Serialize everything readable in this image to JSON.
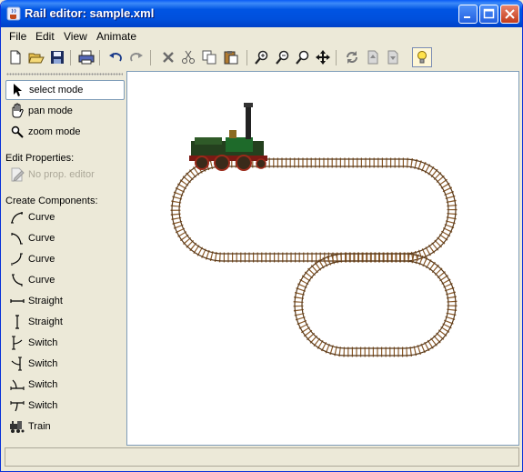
{
  "window": {
    "title": "Rail editor: sample.xml"
  },
  "menu": [
    "File",
    "Edit",
    "View",
    "Animate"
  ],
  "toolbar": {
    "icons": [
      "new-file-icon",
      "open-folder-icon",
      "save-icon",
      "print-icon",
      "undo-icon",
      "redo-icon",
      "delete-icon",
      "cut-icon",
      "copy-icon",
      "paste-icon",
      "zoom-in-icon",
      "zoom-out-icon",
      "zoom-fit-icon",
      "pan-move-icon",
      "rotate-icon",
      "bring-front-icon",
      "send-back-icon",
      "lightbulb-icon"
    ]
  },
  "modes": [
    {
      "label": "select mode",
      "icon": "arrow-cursor-icon",
      "active": true
    },
    {
      "label": "pan mode",
      "icon": "hand-icon",
      "active": false
    },
    {
      "label": "zoom mode",
      "icon": "magnifier-icon",
      "active": false
    }
  ],
  "edit_properties": {
    "heading": "Edit Properties:",
    "editor_label": "No prop. editor"
  },
  "create_components": {
    "heading": "Create Components:",
    "items": [
      {
        "label": "Curve",
        "icon": "curve-ne-icon"
      },
      {
        "label": "Curve",
        "icon": "curve-nw-icon"
      },
      {
        "label": "Curve",
        "icon": "curve-se-icon"
      },
      {
        "label": "Curve",
        "icon": "curve-sw-icon"
      },
      {
        "label": "Straight",
        "icon": "straight-horizontal-icon"
      },
      {
        "label": "Straight",
        "icon": "straight-vertical-icon"
      },
      {
        "label": "Switch",
        "icon": "switch-right-icon"
      },
      {
        "label": "Switch",
        "icon": "switch-left-icon"
      },
      {
        "label": "Switch",
        "icon": "switch-up-icon"
      },
      {
        "label": "Switch",
        "icon": "switch-down-icon"
      },
      {
        "label": "Train",
        "icon": "train-icon"
      }
    ]
  },
  "colors": {
    "titlebar": "#0054e3",
    "window_bg": "#ece9d8",
    "canvas_bg": "#ffffff",
    "rail": "#5a3a1a",
    "tie": "#8a5a2a"
  }
}
